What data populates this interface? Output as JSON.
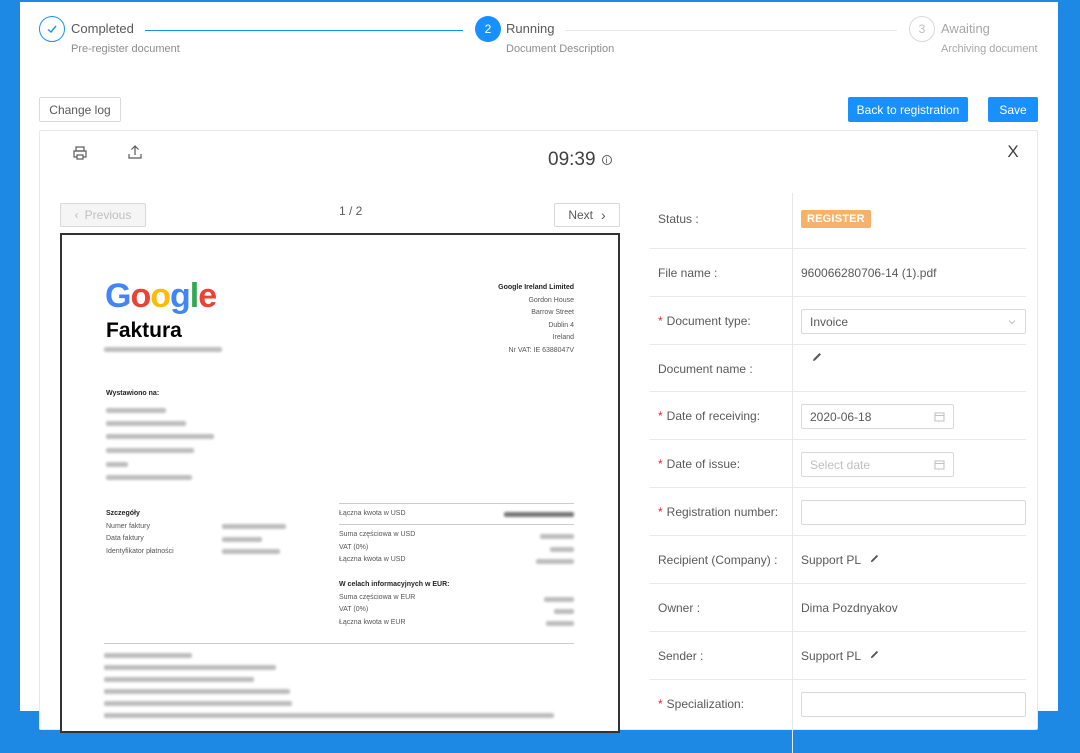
{
  "steps": [
    {
      "title": "Completed",
      "description": "Pre-register document",
      "icon": "check-icon",
      "state": "done"
    },
    {
      "title": "Running",
      "description": "Document Description",
      "number": "2",
      "state": "active"
    },
    {
      "title": "Awaiting",
      "description": "Archiving document",
      "number": "3",
      "state": "waiting"
    }
  ],
  "toolbar": {
    "change_log_label": "Change log",
    "back_label": "Back to registration",
    "save_label": "Save"
  },
  "panel": {
    "time": "09:39",
    "print_icon": "printer-icon",
    "export_icon": "upload-icon",
    "close_icon": "close-icon",
    "close_label": "X"
  },
  "pagination": {
    "previous_label": "Previous",
    "next_label": "Next",
    "page_indicator": "1 / 2"
  },
  "document_preview": {
    "logo": "Google",
    "title": "Faktura",
    "company": "Google Ireland Limited",
    "address": [
      "Gordon House",
      "Barrow Street",
      "Dublin 4",
      "Ireland",
      "Nr VAT: IE 6388047V"
    ],
    "issued_to_label": "Wystawiono na:",
    "details_label": "Szczegóły",
    "details_rows": [
      "Numer faktury",
      "Data faktury",
      "Identyfikator płatności"
    ],
    "usd_total_label": "Łączna kwota w USD",
    "usd_rows": [
      "Suma częściowa w USD",
      "VAT (0%)",
      "Łączna kwota w USD"
    ],
    "eur_label": "W celach informacyjnych w EUR:",
    "eur_rows": [
      "Suma częściowa w EUR",
      "VAT (0%)",
      "Łączna kwota w EUR"
    ]
  },
  "form": {
    "status_label": "Status",
    "status_value": "REGISTER",
    "file_name_label": "File name",
    "file_name_value": "960066280706-14 (1).pdf",
    "document_type_label": "Document type",
    "document_type_value": "Invoice",
    "document_name_label": "Document name",
    "date_receiving_label": "Date of receiving",
    "date_receiving_value": "2020-06-18",
    "date_issue_label": "Date of issue",
    "date_issue_placeholder": "Select date",
    "registration_number_label": "Registration number",
    "registration_number_value": "",
    "recipient_label": "Recipient (Company)",
    "recipient_value": "Support PL",
    "owner_label": "Owner",
    "owner_value": "Dima Pozdnyakov",
    "sender_label": "Sender",
    "sender_value": "Support PL",
    "specialization_label": "Specialization",
    "specialization_value": "",
    "label_suffix": ":"
  },
  "colors": {
    "accent": "#1890ff",
    "status_tag": "#f6b26b",
    "required": "#f5222d",
    "page_background": "#1e88e5"
  }
}
